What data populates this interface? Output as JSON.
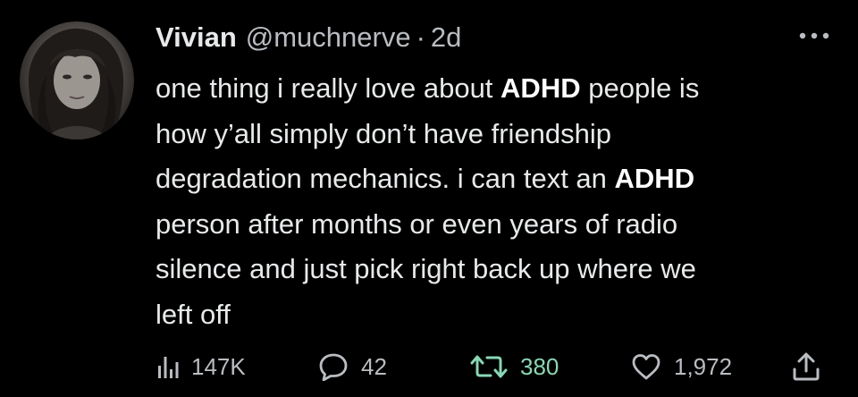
{
  "tweet": {
    "author": {
      "name": "Vivian",
      "handle": "@muchnerve",
      "separator": "·",
      "time": "2d"
    },
    "body": {
      "line1_pre": "one thing i really love about ",
      "line1_bold": "ADHD",
      "line1_post": " people is",
      "line2": "how y’all simply don’t have friendship",
      "line3_pre": "degradation mechanics. i can text an ",
      "line3_bold": "ADHD",
      "line4": "person after months or even years of radio",
      "line5": "silence and just pick right back up where we",
      "line6": "left off"
    },
    "actions": {
      "views": "147K",
      "replies": "42",
      "retweets": "380",
      "likes": "1,972"
    },
    "icons": {
      "views": "bar-chart-icon",
      "replies": "speech-bubble-icon",
      "retweets": "retweet-icon",
      "likes": "heart-icon",
      "share": "share-upload-icon",
      "more": "more-dots-icon"
    },
    "colors": {
      "background": "#000000",
      "text": "#e7e9ea",
      "secondary": "#b9bdc1",
      "retweet_accent": "#87d8b5"
    }
  }
}
